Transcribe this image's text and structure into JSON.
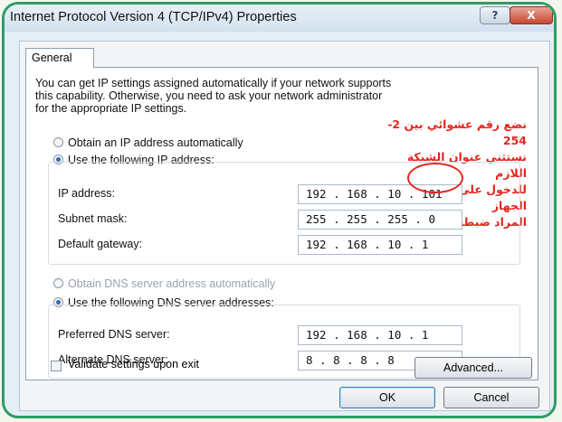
{
  "window": {
    "title": "Internet Protocol Version 4 (TCP/IPv4) Properties",
    "help_label": "?",
    "close_label": "X"
  },
  "tabs": [
    {
      "label": "General",
      "selected": true
    }
  ],
  "intro": "You can get IP settings assigned automatically if your network supports\nthis capability. Otherwise, you need to ask your network administrator\nfor the appropriate IP settings.",
  "ip_section": {
    "auto_label": "Obtain an IP address automatically",
    "manual_label": "Use the following IP address:",
    "selected": "manual",
    "fields": [
      {
        "label": "IP address:",
        "value": "192 . 168 . 10 . 101"
      },
      {
        "label": "Subnet mask:",
        "value": "255 . 255 . 255 . 0"
      },
      {
        "label": "Default gateway:",
        "value": "192 . 168 . 10 . 1"
      }
    ]
  },
  "dns_section": {
    "auto_label": "Obtain DNS server address automatically",
    "manual_label": "Use the following DNS server addresses:",
    "selected": "manual",
    "fields": [
      {
        "label": "Preferred DNS server:",
        "value": "192 . 168 . 10 . 1"
      },
      {
        "label": "Alternate DNS server:",
        "value": "8 . 8 . 8 . 8"
      }
    ]
  },
  "annotation": {
    "lines": [
      "نضع رقم عشوائي بين 2-254",
      "نستثني عنوان الشبكة اللازم",
      "للدخول على إعدادات الجهاز",
      "المراد ضبطه"
    ],
    "color": "#e3261f"
  },
  "validate": {
    "label": "Validate settings upon exit",
    "checked": false
  },
  "buttons": {
    "advanced": "Advanced...",
    "ok": "OK",
    "cancel": "Cancel"
  },
  "colors": {
    "frame_border": "#2e9d63",
    "accent": "#2a6db3"
  }
}
